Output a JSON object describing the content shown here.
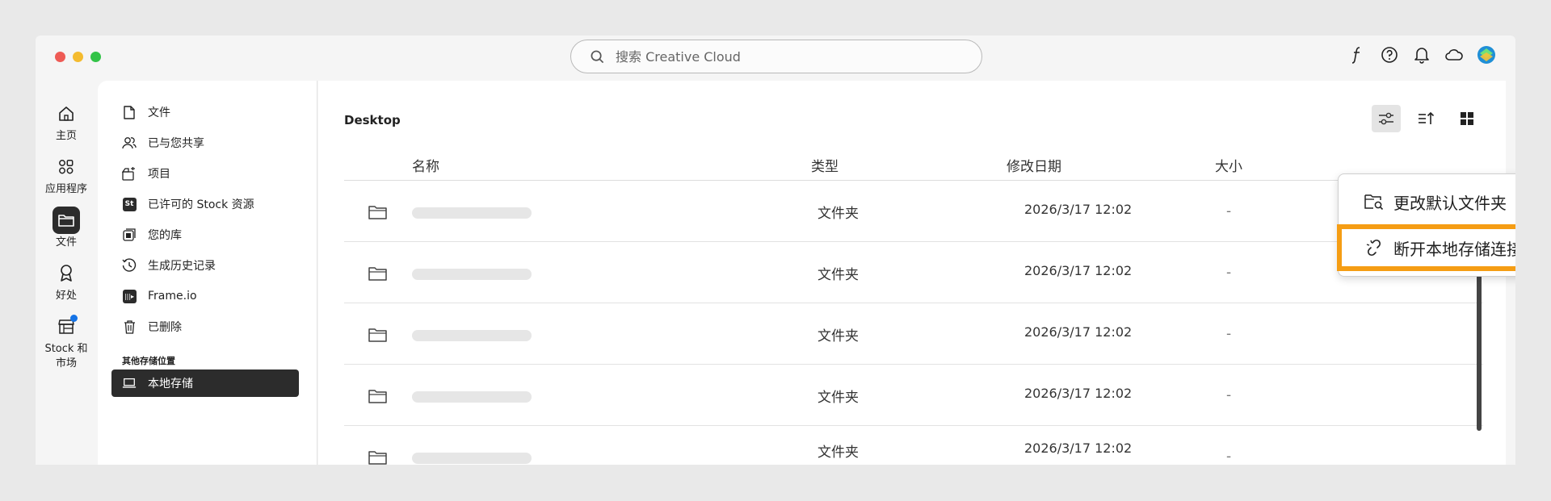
{
  "search": {
    "placeholder": "搜索 Creative Cloud"
  },
  "rail": [
    {
      "label": "主页",
      "icon": "home-icon"
    },
    {
      "label": "应用程序",
      "icon": "apps-icon"
    },
    {
      "label": "文件",
      "icon": "folder-icon",
      "active": true
    },
    {
      "label": "好处",
      "icon": "award-icon"
    },
    {
      "label": "Stock 和 市场",
      "icon": "store-icon"
    }
  ],
  "sidebar": {
    "items": [
      {
        "label": "文件",
        "icon": "file-icon"
      },
      {
        "label": "已与您共享",
        "icon": "shared-users-icon"
      },
      {
        "label": "项目",
        "icon": "project-icon"
      },
      {
        "label": "已许可的 Stock 资源",
        "icon": "stock-badge-icon",
        "badge": "St"
      },
      {
        "label": "您的库",
        "icon": "library-icon"
      },
      {
        "label": "生成历史记录",
        "icon": "history-icon"
      },
      {
        "label": "Frame.io",
        "icon": "frameio-icon",
        "badge": "|||▸"
      },
      {
        "label": "已删除",
        "icon": "trash-icon"
      }
    ],
    "section_label": "其他存储位置",
    "local_storage": {
      "label": "本地存储",
      "icon": "laptop-icon"
    }
  },
  "main": {
    "breadcrumb": "Desktop",
    "columns": {
      "name": "名称",
      "type": "类型",
      "modified": "修改日期",
      "size": "大小"
    },
    "rows": [
      {
        "type": "文件夹",
        "modified": "2026/3/17 12:02",
        "size": "-"
      },
      {
        "type": "文件夹",
        "modified": "2026/3/17 12:02",
        "size": "-"
      },
      {
        "type": "文件夹",
        "modified": "2026/3/17 12:02",
        "size": "-"
      },
      {
        "type": "文件夹",
        "modified": "2026/3/17 12:02",
        "size": "-"
      },
      {
        "type": "文件夹",
        "modified": "2026/3/17 12:02",
        "size": "-"
      }
    ]
  },
  "context_menu": {
    "change_default_folder": "更改默认文件夹",
    "disconnect_local_storage": "断开本地存储连接"
  },
  "colors": {
    "highlight": "#f59d14",
    "active_dark": "#2c2c2c"
  }
}
